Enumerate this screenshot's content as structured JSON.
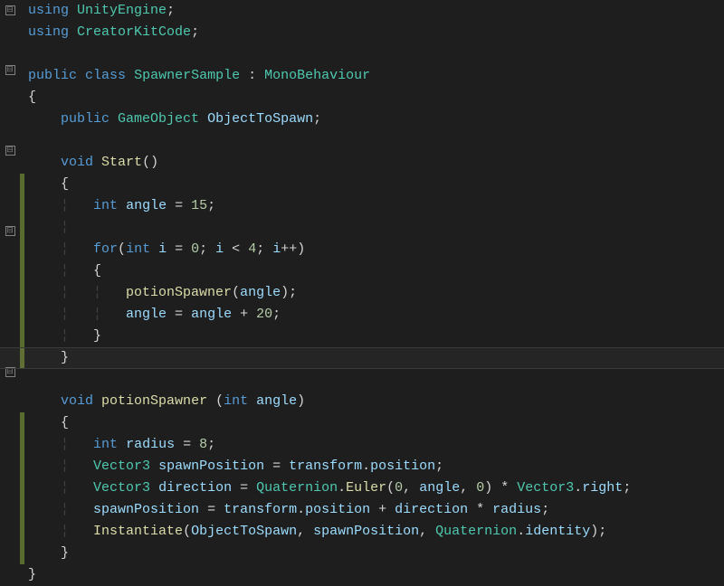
{
  "lines": {
    "l1": {
      "kw1": "using",
      "type": "UnityEngine",
      "p": ";"
    },
    "l2": {
      "kw1": "using",
      "type": "CreatorKitCode",
      "p": ";"
    },
    "l3": "",
    "l4": {
      "kw1": "public",
      "kw2": "class",
      "type": "SpawnerSample",
      "colon": " : ",
      "base": "MonoBehaviour"
    },
    "l5": "{",
    "l6": {
      "kw1": "public",
      "type": "GameObject",
      "name": "ObjectToSpawn",
      "p": ";"
    },
    "l7": "",
    "l8": {
      "kw1": "void",
      "meth": "Start",
      "parens": "()"
    },
    "l9": "{",
    "l10": {
      "kw": "int",
      "name": "angle",
      "op": " = ",
      "num": "15",
      "p": ";"
    },
    "l11": "",
    "l12": {
      "kw": "for",
      "p1": "(",
      "kw2": "int",
      "var": "i",
      "eq": " = ",
      "n1": "0",
      "sc1": "; ",
      "var2": "i",
      "lt": " < ",
      "n2": "4",
      "sc2": "; ",
      "var3": "i",
      "inc": "++",
      "p2": ")"
    },
    "l13": "{",
    "l14": {
      "meth": "potionSpawner",
      "p1": "(",
      "arg": "angle",
      "p2": ");"
    },
    "l15": {
      "var": "angle",
      "eq": " = ",
      "var2": "angle",
      "plus": " + ",
      "num": "20",
      "p": ";"
    },
    "l16": "}",
    "l17": "}",
    "l18": "",
    "l19": {
      "kw": "void",
      "meth": "potionSpawner",
      "sp": " ",
      "p1": "(",
      "kw2": "int",
      "arg": "angle",
      "p2": ")"
    },
    "l20": "{",
    "l21": {
      "kw": "int",
      "name": "radius",
      "eq": " = ",
      "num": "8",
      "p": ";"
    },
    "l22": {
      "type": "Vector3",
      "name": "spawnPosition",
      "eq": " = ",
      "obj": "transform",
      "dot": ".",
      "prop": "position",
      "p": ";"
    },
    "l23": {
      "type": "Vector3",
      "name": "direction",
      "eq": " = ",
      "type2": "Quaternion",
      "dot": ".",
      "meth": "Euler",
      "p1": "(",
      "n1": "0",
      "c1": ", ",
      "arg": "angle",
      "c2": ", ",
      "n2": "0",
      "p2": ")",
      "mul": " * ",
      "type3": "Vector3",
      "dot2": ".",
      "prop": "right",
      "p3": ";"
    },
    "l24": {
      "name": "spawnPosition",
      "eq": " = ",
      "obj": "transform",
      "dot": ".",
      "prop": "position",
      "plus": " + ",
      "var": "direction",
      "mul": " * ",
      "var2": "radius",
      "p": ";"
    },
    "l25": {
      "meth": "Instantiate",
      "p1": "(",
      "arg1": "ObjectToSpawn",
      "c1": ", ",
      "arg2": "spawnPosition",
      "c2": ", ",
      "type": "Quaternion",
      "dot": ".",
      "prop": "identity",
      "p2": ");"
    },
    "l26": "}",
    "l27": "}"
  },
  "fold_glyph": "⊟"
}
